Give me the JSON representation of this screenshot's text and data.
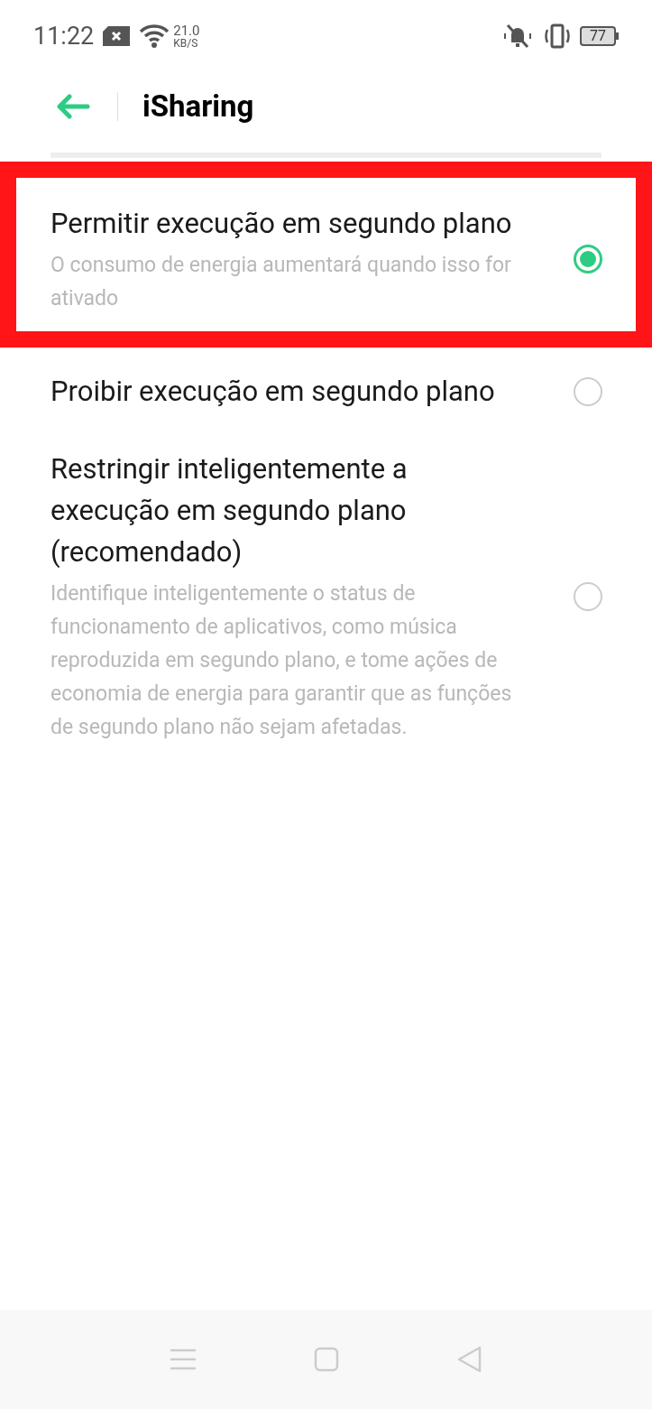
{
  "status_bar": {
    "time": "11:22",
    "speed_value": "21.0",
    "speed_unit": "KB/S",
    "battery": "77"
  },
  "header": {
    "title": "iSharing"
  },
  "options": [
    {
      "title": "Permitir execução em segundo plano",
      "description": "O consumo de energia aumentará quando isso for ativado",
      "selected": true,
      "highlighted": true
    },
    {
      "title": "Proibir execução em segundo plano",
      "selected": false,
      "highlighted": false
    },
    {
      "title": "Restringir inteligentemente a execução em segundo plano (recomendado)",
      "description": "Identifique inteligentemente o status de funcionamento de aplicativos, como música reproduzida em segundo plano, e tome ações de economia de energia para garantir que as funções de segundo plano não sejam afetadas.",
      "selected": false,
      "highlighted": false
    }
  ]
}
